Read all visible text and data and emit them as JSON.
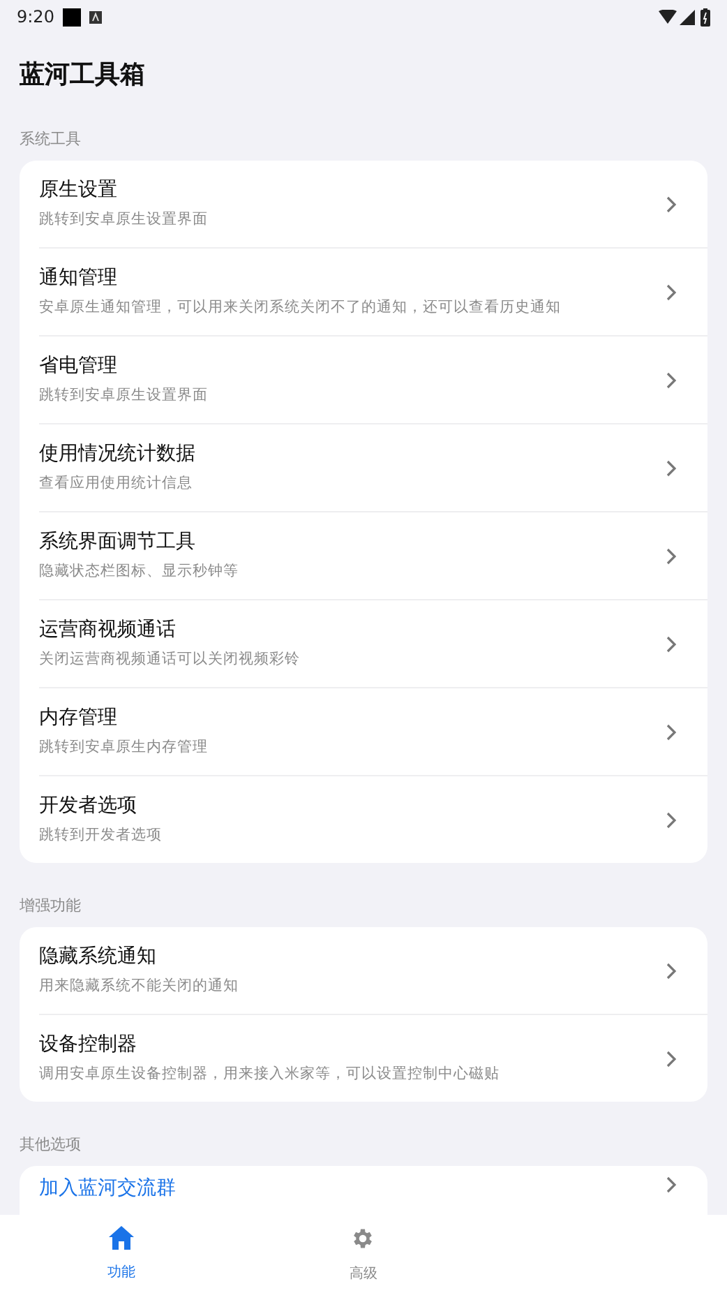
{
  "status_bar": {
    "time": "9:20"
  },
  "title": "蓝河工具箱",
  "sections": [
    {
      "header": "系统工具",
      "items": [
        {
          "kind": "setting",
          "title": "原生设置",
          "subtitle": "跳转到安卓原生设置界面"
        },
        {
          "kind": "setting",
          "title": "通知管理",
          "subtitle": "安卓原生通知管理，可以用来关闭系统关闭不了的通知，还可以查看历史通知"
        },
        {
          "kind": "setting",
          "title": "省电管理",
          "subtitle": "跳转到安卓原生设置界面"
        },
        {
          "kind": "setting",
          "title": "使用情况统计数据",
          "subtitle": "查看应用使用统计信息"
        },
        {
          "kind": "setting",
          "title": "系统界面调节工具",
          "subtitle": "隐藏状态栏图标、显示秒钟等"
        },
        {
          "kind": "setting",
          "title": "运营商视频通话",
          "subtitle": "关闭运营商视频通话可以关闭视频彩铃"
        },
        {
          "kind": "setting",
          "title": "内存管理",
          "subtitle": "跳转到安卓原生内存管理"
        },
        {
          "kind": "setting",
          "title": "开发者选项",
          "subtitle": "跳转到开发者选项"
        }
      ]
    },
    {
      "header": "增强功能",
      "items": [
        {
          "kind": "setting",
          "title": "隐藏系统通知",
          "subtitle": "用来隐藏系统不能关闭的通知"
        },
        {
          "kind": "setting",
          "title": "设备控制器",
          "subtitle": "调用安卓原生设备控制器，用来接入米家等，可以设置控制中心磁贴"
        }
      ]
    },
    {
      "header": "其他选项",
      "items": [
        {
          "kind": "link",
          "title": "加入蓝河交流群"
        }
      ]
    }
  ],
  "nav": [
    {
      "kind": "home",
      "label": "功能",
      "selected": true
    },
    {
      "kind": "gear",
      "label": "高级",
      "selected": false
    }
  ]
}
